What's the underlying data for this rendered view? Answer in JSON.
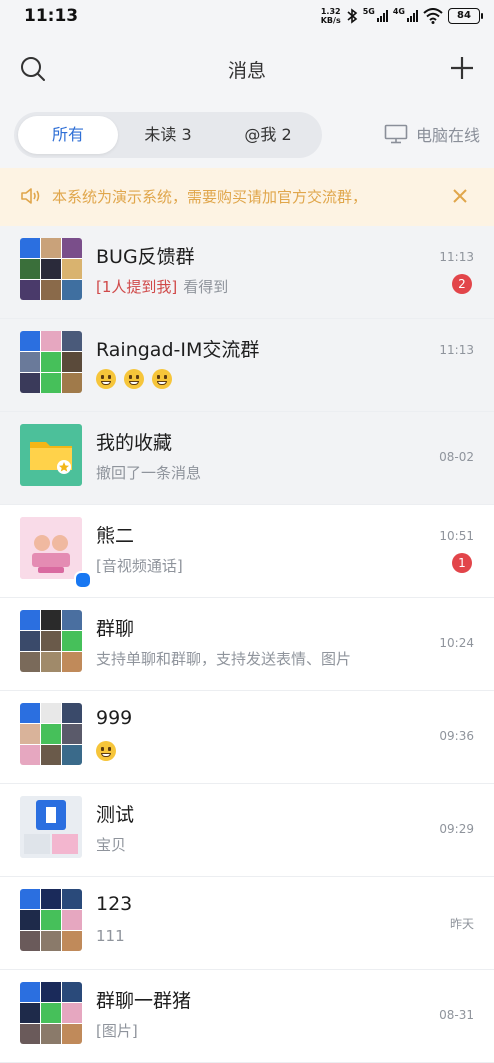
{
  "status_bar": {
    "time": "11:13",
    "speed_value": "1.32",
    "speed_unit": "KB/s",
    "net1": "5G",
    "net2": "4G",
    "battery": "84"
  },
  "header": {
    "title": "消息",
    "icons": [
      "search-icon",
      "add-icon"
    ]
  },
  "tabs": {
    "items": [
      {
        "label": "所有",
        "active": true
      },
      {
        "label": "未读 3",
        "active": false
      },
      {
        "label": "@我 2",
        "active": false
      }
    ],
    "pc_online": "电脑在线"
  },
  "notice": {
    "text": "本系统为演示系统，需要购买请加官方交流群，"
  },
  "conversations": [
    {
      "title": "BUG反馈群",
      "mention": "[1人提到我]",
      "preview": "看得到",
      "time": "11:13",
      "badge": "2",
      "pinned": true
    },
    {
      "title": "Raingad-IM交流群",
      "preview": "",
      "emojis": 3,
      "time": "11:13",
      "pinned": true
    },
    {
      "title": "我的收藏",
      "preview": "撤回了一条消息",
      "time": "08-02",
      "pinned": true
    },
    {
      "title": "熊二",
      "preview": "[音视频通话]",
      "time": "10:51",
      "badge": "1"
    },
    {
      "title": "群聊",
      "preview": "支持单聊和群聊，支持发送表情、图片",
      "time": "10:24"
    },
    {
      "title": "999",
      "preview": "",
      "emojis": 1,
      "time": "09:36"
    },
    {
      "title": "测试",
      "preview": "宝贝",
      "time": "09:29"
    },
    {
      "title": "123",
      "preview": "111",
      "time": "昨天"
    },
    {
      "title": "群聊一群猪",
      "preview": "[图片]",
      "time": "08-31"
    }
  ],
  "colors": {
    "accent": "#2f6fd6",
    "badge": "#e2454a",
    "notice_bg": "#fdf3e3",
    "notice_text": "#e0a64b"
  }
}
